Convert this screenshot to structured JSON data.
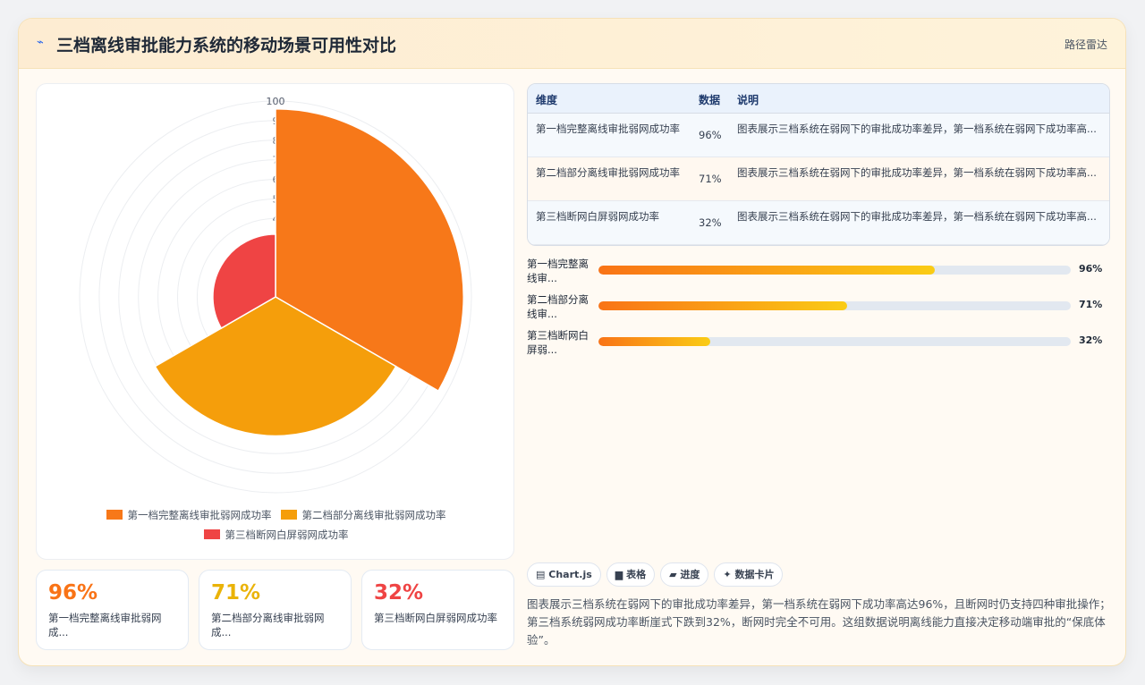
{
  "header": {
    "icon": "bolt-icon",
    "title": "三档离线审批能力系统的移动场景可用性对比",
    "tag": "路径雷达"
  },
  "chart_data": {
    "type": "polarArea",
    "categories": [
      "第一档完整离线审批弱网成功率",
      "第二档部分离线审批弱网成功率",
      "第三档断网白屏弱网成功率"
    ],
    "values": [
      96,
      71,
      32
    ],
    "colors": [
      "#f77819",
      "#f59e0b",
      "#ef4444"
    ],
    "rlim": [
      0,
      100
    ],
    "ticks": [
      100,
      90,
      80,
      70,
      60,
      50,
      40,
      30,
      20
    ],
    "tick_labels": [
      "100",
      "9",
      "8",
      "7",
      "6",
      "5",
      "4",
      "3",
      "2"
    ],
    "legend_position": "bottom"
  },
  "stats": [
    {
      "value": "96%",
      "label": "第一档完整离线审批弱网成...",
      "color": "#f97316"
    },
    {
      "value": "71%",
      "label": "第二档部分离线审批弱网成...",
      "color": "#eab308"
    },
    {
      "value": "32%",
      "label": "第三档断网白屏弱网成功率",
      "color": "#ef4444"
    }
  ],
  "table": {
    "headers": [
      "维度",
      "数据",
      "说明"
    ],
    "rows": [
      {
        "dim": "第一档完整离线审批弱网成功率",
        "val": "96%",
        "desc": "图表展示三档系统在弱网下的审批成功率差异，第一档系统在弱网下成功率高..."
      },
      {
        "dim": "第二档部分离线审批弱网成功率",
        "val": "71%",
        "desc": "图表展示三档系统在弱网下的审批成功率差异，第一档系统在弱网下成功率高..."
      },
      {
        "dim": "第三档断网白屏弱网成功率",
        "val": "32%",
        "desc": "图表展示三档系统在弱网下的审批成功率差异，第一档系统在弱网下成功率高..."
      }
    ]
  },
  "progress": [
    {
      "label": "第一档完整离线审...",
      "value": 96,
      "text": "96%",
      "fill": 0.713
    },
    {
      "label": "第二档部分离线审...",
      "value": 71,
      "text": "71%",
      "fill": 0.527
    },
    {
      "label": "第三档断网白屏弱...",
      "value": 32,
      "text": "32%",
      "fill": 0.237
    }
  ],
  "chips": [
    {
      "icon": "chart-icon",
      "glyph": "▤",
      "label": "Chart.js"
    },
    {
      "icon": "table-icon",
      "glyph": "▆",
      "label": "表格"
    },
    {
      "icon": "progress-icon",
      "glyph": "▰",
      "label": "进度"
    },
    {
      "icon": "card-icon",
      "glyph": "✦",
      "label": "数据卡片"
    }
  ],
  "summary": "图表展示三档系统在弱网下的审批成功率差异，第一档系统在弱网下成功率高达96%，且断网时仍支持四种审批操作；第三档系统弱网成功率断崖式下跌到32%，断网时完全不可用。这组数据说明离线能力直接决定移动端审批的“保底体验”。"
}
